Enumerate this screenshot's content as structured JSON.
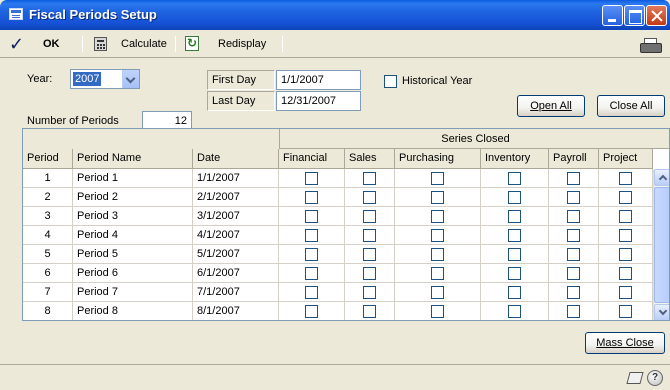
{
  "window": {
    "title": "Fiscal Periods Setup"
  },
  "toolbar": {
    "ok_label": "OK",
    "calculate_label": "Calculate",
    "redisplay_label": "Redisplay"
  },
  "form": {
    "year_label": "Year:",
    "year_value": "2007",
    "first_day_label": "First Day",
    "first_day_value": "1/1/2007",
    "last_day_label": "Last Day",
    "last_day_value": "12/31/2007",
    "historical_year_label": "Historical Year",
    "historical_year_checked": false,
    "number_of_periods_label": "Number of Periods",
    "number_of_periods_value": "12",
    "open_all_label": "Open All",
    "close_all_label": "Close All"
  },
  "grid": {
    "group_header": "Series Closed",
    "columns": [
      "Period",
      "Period Name",
      "Date",
      "Financial",
      "Sales",
      "Purchasing",
      "Inventory",
      "Payroll",
      "Project"
    ],
    "rows": [
      {
        "period": "1",
        "name": "Period 1",
        "date": "1/1/2007"
      },
      {
        "period": "2",
        "name": "Period 2",
        "date": "2/1/2007"
      },
      {
        "period": "3",
        "name": "Period 3",
        "date": "3/1/2007"
      },
      {
        "period": "4",
        "name": "Period 4",
        "date": "4/1/2007"
      },
      {
        "period": "5",
        "name": "Period 5",
        "date": "5/1/2007"
      },
      {
        "period": "6",
        "name": "Period 6",
        "date": "6/1/2007"
      },
      {
        "period": "7",
        "name": "Period 7",
        "date": "7/1/2007"
      },
      {
        "period": "8",
        "name": "Period 8",
        "date": "8/1/2007"
      }
    ]
  },
  "footer": {
    "mass_close_label": "Mass Close"
  },
  "icons": {
    "window": "window-icon",
    "ok": "check-icon",
    "calculate": "calculator-icon",
    "redisplay": "refresh-icon",
    "print": "printer-icon",
    "note": "note-icon",
    "help": "help-icon"
  },
  "colors": {
    "titlebar": "#1d63e0",
    "selection": "#316ac5",
    "face": "#ece9d8"
  }
}
